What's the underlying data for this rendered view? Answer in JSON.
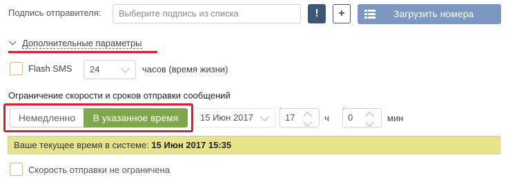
{
  "sender": {
    "label": "Подпись отправителя:",
    "placeholder": "Выберите подпись из списка",
    "alert_button": "!",
    "add_button": "+",
    "upload_button": "Загрузить номера"
  },
  "advanced": {
    "toggle_label": "Дополнительные параметры"
  },
  "flash": {
    "label": "Flash SMS",
    "hours_value": "24",
    "hours_suffix": "часов (время жизни)"
  },
  "limits": {
    "title": "Ограничение скорости и сроков отправки сообщений",
    "mode_immediate": "Немедленно",
    "mode_scheduled": "В указанное время",
    "date_value": "15 Июн 2017",
    "hour_value": "17",
    "hour_unit": "ч",
    "minute_value": "0",
    "minute_unit": "мин",
    "required_mark": "*"
  },
  "system_time": {
    "prefix": "Ваше текущее время в системе:",
    "value": "15 Июн 2017 15:35"
  },
  "speed": {
    "label": "Скорость отправки не ограничена"
  },
  "colors": {
    "dark_button": "#3c5675",
    "primary_button": "#7b97c2",
    "active_segment": "#7ea84b",
    "info_bar": "#e8e48c",
    "highlight_red": "#e01b2c"
  }
}
